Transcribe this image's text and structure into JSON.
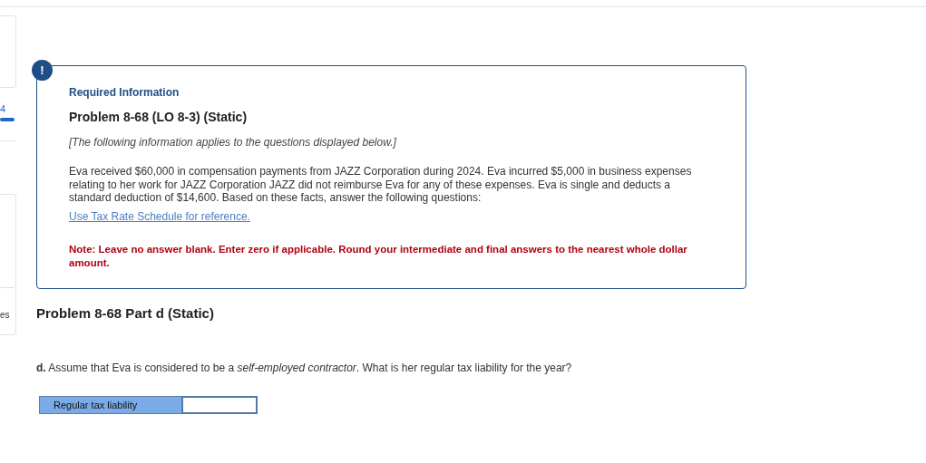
{
  "sidebar": {
    "fragments": [
      {
        "text": "4",
        "kind": "link"
      },
      {
        "text": "es",
        "kind": "label"
      }
    ]
  },
  "info": {
    "icon": "!",
    "heading": "Required Information",
    "title": "Problem 8-68 (LO 8-3) (Static)",
    "intro": "[The following information applies to the questions displayed below.]",
    "body": "Eva received $60,000 in compensation payments from JAZZ Corporation during 2024. Eva incurred $5,000 in business expenses relating to her work for JAZZ Corporation JAZZ did not reimburse Eva for any of these expenses. Eva is single and deducts a standard deduction of $14,600. Based on these facts, answer the following questions:",
    "link": "Use Tax Rate Schedule for reference.",
    "note": "Note: Leave no answer blank. Enter zero if applicable. Round your intermediate and final answers to the nearest whole dollar amount."
  },
  "part": {
    "title": "Problem 8-68 Part d (Static)",
    "question": "**d.** Assume that Eva is considered to be a *self-employed contractor*. What is her regular tax liability for the year?",
    "answer_label": "Regular tax liability"
  }
}
